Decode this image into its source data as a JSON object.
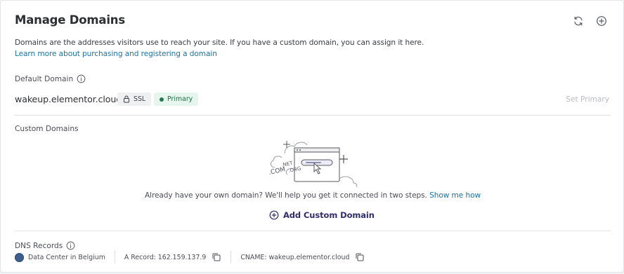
{
  "header": {
    "title": "Manage Domains",
    "refresh_icon": "refresh-icon",
    "add_icon": "add-circle-icon"
  },
  "intro": {
    "description": "Domains are the addresses visitors use to reach your site. If you have a custom domain, you can assign it here.",
    "learn_link": "Learn more about purchasing and registering a domain"
  },
  "default_domain": {
    "label": "Default Domain",
    "domain": "wakeup.elementor.cloud",
    "ssl_badge": "SSL",
    "primary_badge": "Primary",
    "set_primary": "Set Primary"
  },
  "custom_domains": {
    "label": "Custom Domains",
    "illustration_text_1": ".NET",
    "illustration_text_2": ".COM",
    "illustration_text_3": ".ORG",
    "empty_text": "Already have your own domain? We'll help you get it connected in two steps.",
    "show_me_how": "Show me how",
    "add_button": "Add Custom Domain"
  },
  "dns": {
    "label": "DNS Records",
    "data_center": "Data Center in Belgium",
    "a_record": "A Record: 162.159.137.9",
    "cname": "CNAME: wakeup.elementor.cloud"
  },
  "colors": {
    "link": "#1a73a8",
    "primary_badge_bg": "#e6f6ee",
    "primary_badge_text": "#1d6b46",
    "add_button_text": "#2f2d6e"
  }
}
